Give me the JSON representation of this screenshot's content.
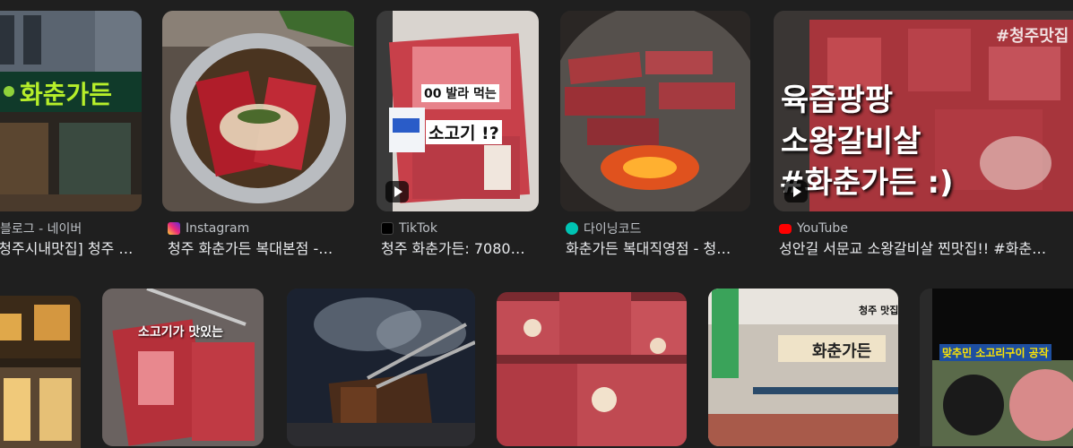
{
  "row1": [
    {
      "source": "블로그 - 네이버",
      "title": "[청주시내맛집] 청주 …",
      "icon": "naver-blog-icon",
      "sign_text": "화춘가든"
    },
    {
      "source": "Instagram",
      "title": "청주 화춘가든 복대본점 -…",
      "icon": "instagram-icon"
    },
    {
      "source": "TikTok",
      "title": "청주 화춘가든: 7080…",
      "icon": "tiktok-icon",
      "overlay_1": "00 발라 먹는",
      "overlay_2": "소고기 !?"
    },
    {
      "source": "다이닝코드",
      "title": "화춘가든 복대직영점 - 청…",
      "icon": "diningcode-icon"
    },
    {
      "source": "YouTube",
      "title": "성안길 서문교 소왕갈비살 찐맛집!! #화춘…",
      "icon": "youtube-icon",
      "overlay_1": "육즙팡팡",
      "overlay_2": "소왕갈비살",
      "overlay_3": "#화춘가든 :)",
      "corner_tag": "#청주맛집"
    }
  ],
  "row2": [
    {
      "name": "storefront-night"
    },
    {
      "name": "grilled-meat",
      "overlay_1": "소고기가 맛있는"
    },
    {
      "name": "smoky-grill"
    },
    {
      "name": "raw-beef-platter"
    },
    {
      "name": "storefront-day",
      "corner_tag": "청주 맛집",
      "sign_text": "화춘가든"
    },
    {
      "name": "tv-capture",
      "overlay_1": "맞추민 소고리구이 공작"
    }
  ],
  "colors": {
    "background": "#1f1f1f",
    "title_text": "#e8eaed",
    "source_text": "#bdc1c6",
    "youtube_red": "#ff0000"
  }
}
